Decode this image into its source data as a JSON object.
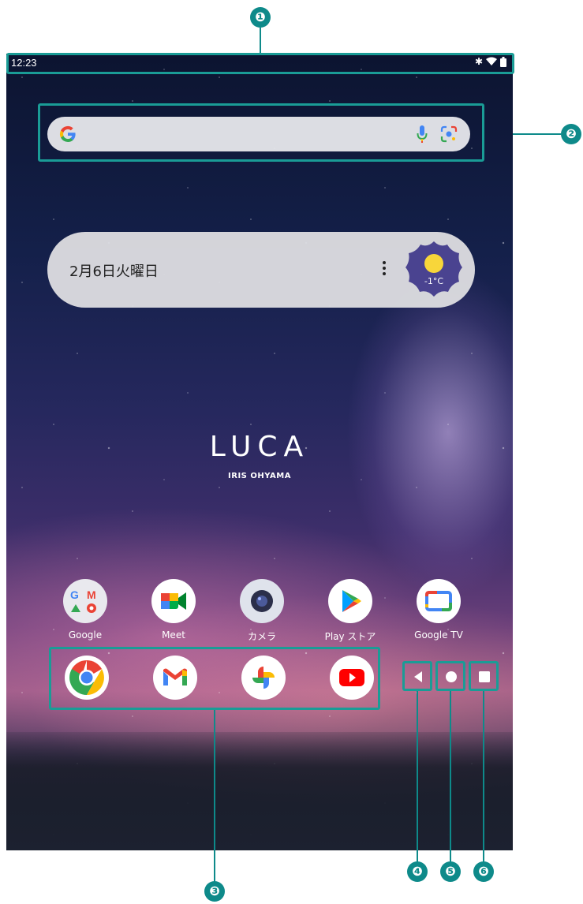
{
  "callouts": [
    "❶",
    "❷",
    "❸",
    "❹",
    "❺",
    "❻"
  ],
  "status_bar": {
    "time": "12:23",
    "icons": [
      "bluetooth-icon",
      "wifi-icon",
      "battery-icon"
    ]
  },
  "search": {
    "logo": "G",
    "icons": [
      "google-logo-icon",
      "mic-icon",
      "lens-icon"
    ]
  },
  "date_widget": {
    "date": "2月6日火曜日",
    "temperature": "-1°C",
    "icons": [
      "more-vert-icon",
      "sun-icon"
    ]
  },
  "wallpaper": {
    "brand": "LUCA",
    "maker": "IRIS OHYAMA"
  },
  "apps": [
    {
      "label": "Google",
      "icon": "google-folder-icon"
    },
    {
      "label": "Meet",
      "icon": "meet-icon"
    },
    {
      "label": "カメラ",
      "icon": "camera-icon"
    },
    {
      "label": "Play ストア",
      "icon": "play-store-icon"
    },
    {
      "label": "Google TV",
      "icon": "google-tv-icon"
    }
  ],
  "dock": [
    "chrome-icon",
    "gmail-icon",
    "photos-icon",
    "youtube-icon"
  ],
  "nav": [
    "back-icon",
    "home-icon",
    "recents-icon"
  ],
  "colors": {
    "callout": "#0e8a8a",
    "frame": "#1a9c96",
    "google_blue": "#4285f4",
    "google_red": "#ea4335",
    "google_yellow": "#fbbc05",
    "google_green": "#34a853",
    "weather_badge": "#4a4390",
    "sun": "#f8d63a"
  }
}
